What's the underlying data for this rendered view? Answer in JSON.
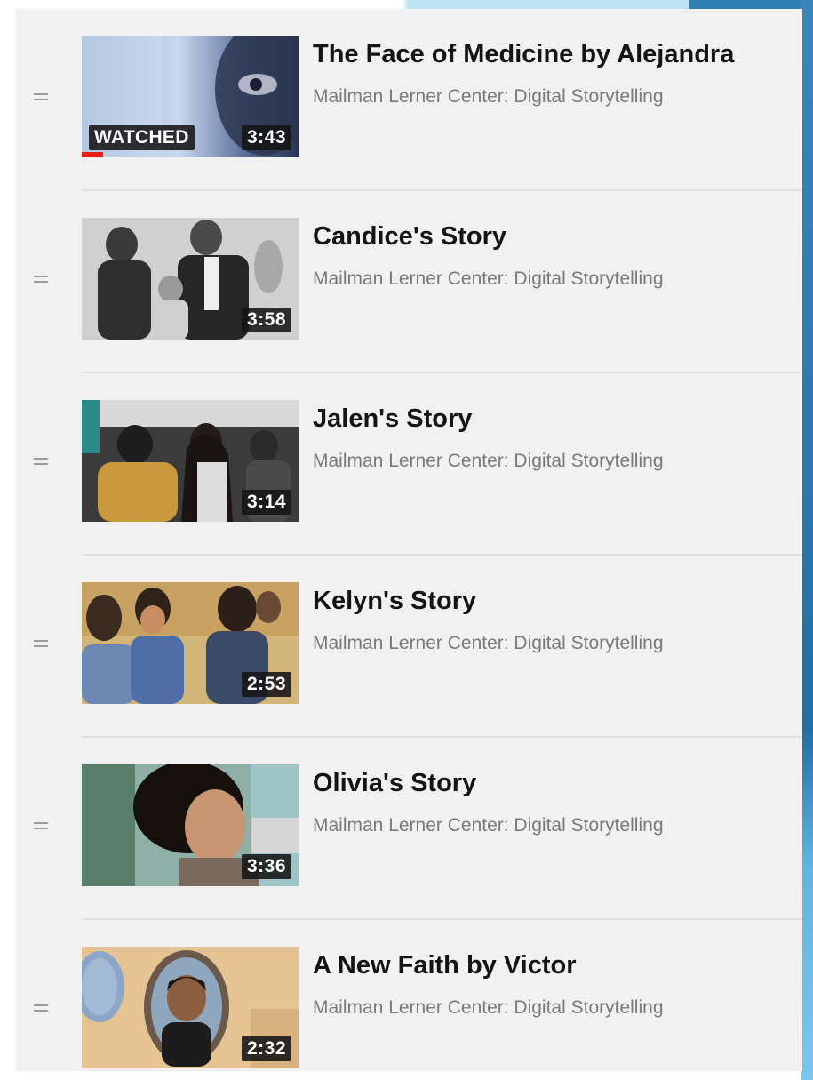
{
  "playlist": {
    "items": [
      {
        "title": "The Face of Medicine by Alejandra",
        "channel": "Mailman Lerner Center: Digital Storytelling",
        "duration": "3:43",
        "watched_label": "WATCHED",
        "watched_progress_percent": 10
      },
      {
        "title": "Candice's Story",
        "channel": "Mailman Lerner Center: Digital Storytelling",
        "duration": "3:58"
      },
      {
        "title": "Jalen's Story",
        "channel": "Mailman Lerner Center: Digital Storytelling",
        "duration": "3:14"
      },
      {
        "title": "Kelyn's Story",
        "channel": "Mailman Lerner Center: Digital Storytelling",
        "duration": "2:53"
      },
      {
        "title": "Olivia's Story",
        "channel": "Mailman Lerner Center: Digital Storytelling",
        "duration": "3:36"
      },
      {
        "title": "A New Faith by Victor",
        "channel": "Mailman Lerner Center: Digital Storytelling",
        "duration": "2:32"
      }
    ]
  },
  "colors": {
    "panel_bg": "#f1f1f1",
    "title_text": "#141414",
    "channel_text": "#7a7a7a",
    "progress_red": "#e62117",
    "accent_blue": "#2f7fb0"
  },
  "icons": {
    "drag_handle": "drag-handle-icon"
  }
}
